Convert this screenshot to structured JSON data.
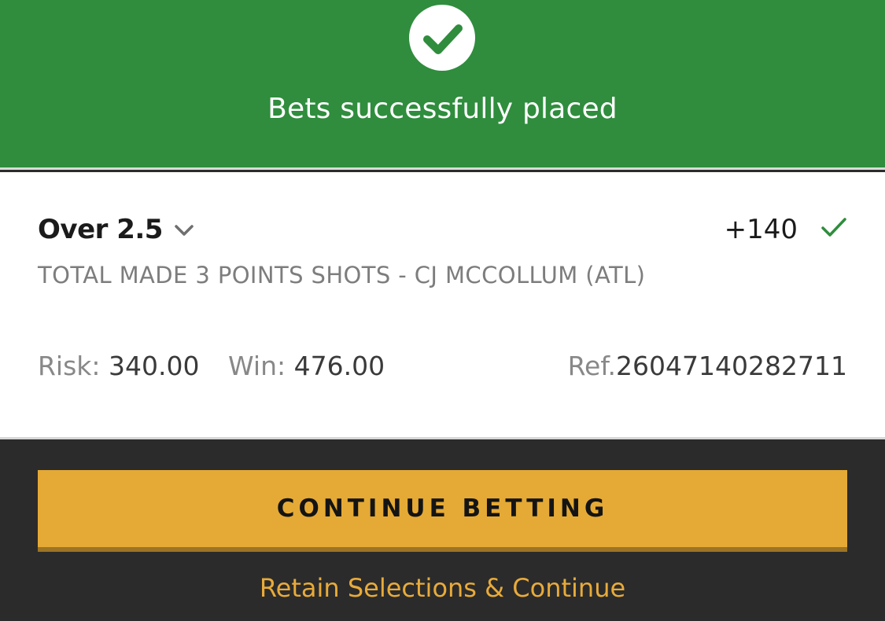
{
  "banner": {
    "title": "Bets successfully placed",
    "icon": "check-circle-icon",
    "color": "#2f8d3d"
  },
  "bet": {
    "selection": "Over 2.5",
    "odds": "+140",
    "market": "TOTAL MADE 3 POINTS SHOTS - CJ MCCOLLUM (ATL)",
    "risk_label": "Risk:",
    "risk_value": "340.00",
    "win_label": "Win:",
    "win_value": "476.00",
    "ref_label": "Ref.",
    "ref_value": "26047140282711",
    "status_icon": "checkmark-icon",
    "expand_icon": "chevron-down-icon"
  },
  "actions": {
    "continue_label": "CONTINUE BETTING",
    "retain_label": "Retain Selections & Continue",
    "accent_color": "#e5aa35"
  }
}
